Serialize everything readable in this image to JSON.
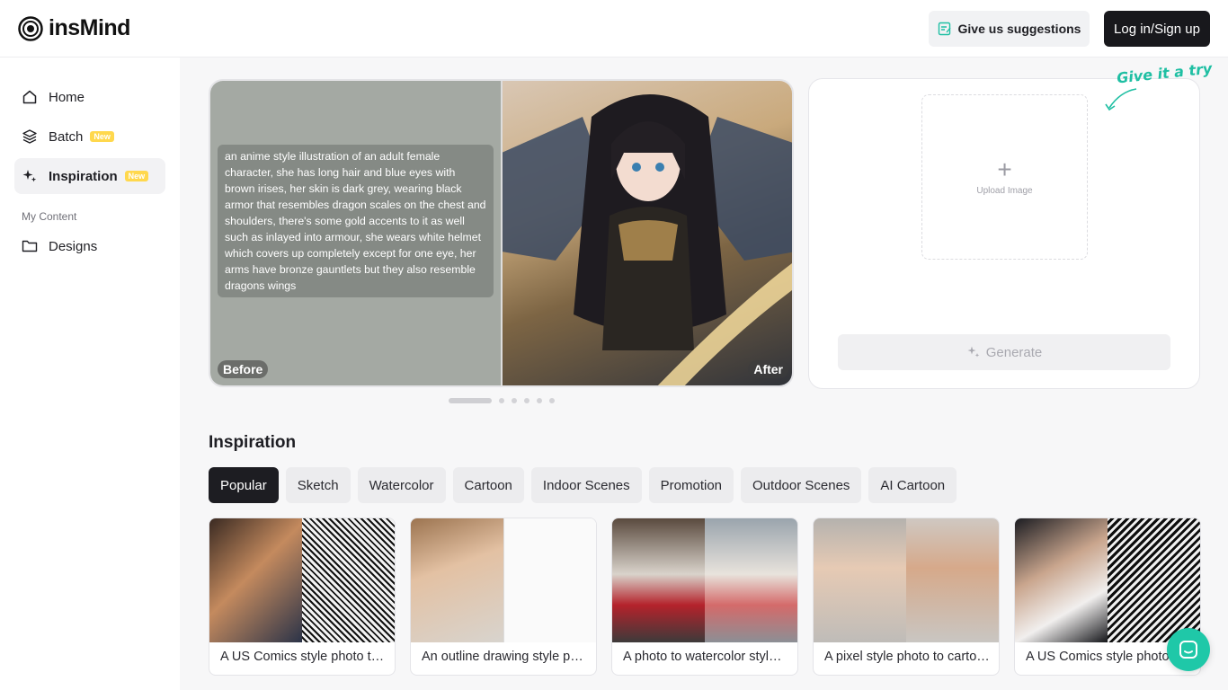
{
  "header": {
    "logo_text": "insMind",
    "suggest_label": "Give us suggestions",
    "login_label": "Log in/Sign up"
  },
  "sidebar": {
    "items": [
      {
        "label": "Home",
        "icon": "home-icon"
      },
      {
        "label": "Batch",
        "icon": "layers-icon",
        "badge": "New"
      },
      {
        "label": "Inspiration",
        "icon": "sparkle-icon",
        "badge": "New",
        "active": true
      }
    ],
    "section_label": "My Content",
    "content_items": [
      {
        "label": "Designs",
        "icon": "folder-icon"
      }
    ]
  },
  "showcase": {
    "prompt": "an anime style illustration of an adult female character, she has long hair and blue eyes with brown irises, her skin is dark grey, wearing black armor that resembles dragon scales on the chest and shoulders, there's some gold accents to it as well such as inlayed into armour, she wears white helmet which covers up completely except for one eye, her arms have bronze gauntlets but they also resemble dragons wings",
    "before_label": "Before",
    "after_label": "After",
    "slide_count": 6,
    "active_slide": 1
  },
  "generator": {
    "try_label": "Give it a try",
    "upload_label": "Upload Image",
    "generate_label": "Generate"
  },
  "inspiration": {
    "title": "Inspiration",
    "tabs": [
      "Popular",
      "Sketch",
      "Watercolor",
      "Cartoon",
      "Indoor Scenes",
      "Promotion",
      "Outdoor Scenes",
      "AI Cartoon"
    ],
    "active_tab": "Popular",
    "cards": [
      {
        "title": "A US Comics style photo to comics"
      },
      {
        "title": "An outline drawing style photo to sketch"
      },
      {
        "title": "A photo to watercolor style painting"
      },
      {
        "title": "A pixel style photo to cartoon"
      },
      {
        "title": "A US Comics style photo to comics"
      }
    ]
  },
  "colors": {
    "accent": "#1fc8a8",
    "primary_dark": "#18181c",
    "badge": "#ffd84d"
  }
}
